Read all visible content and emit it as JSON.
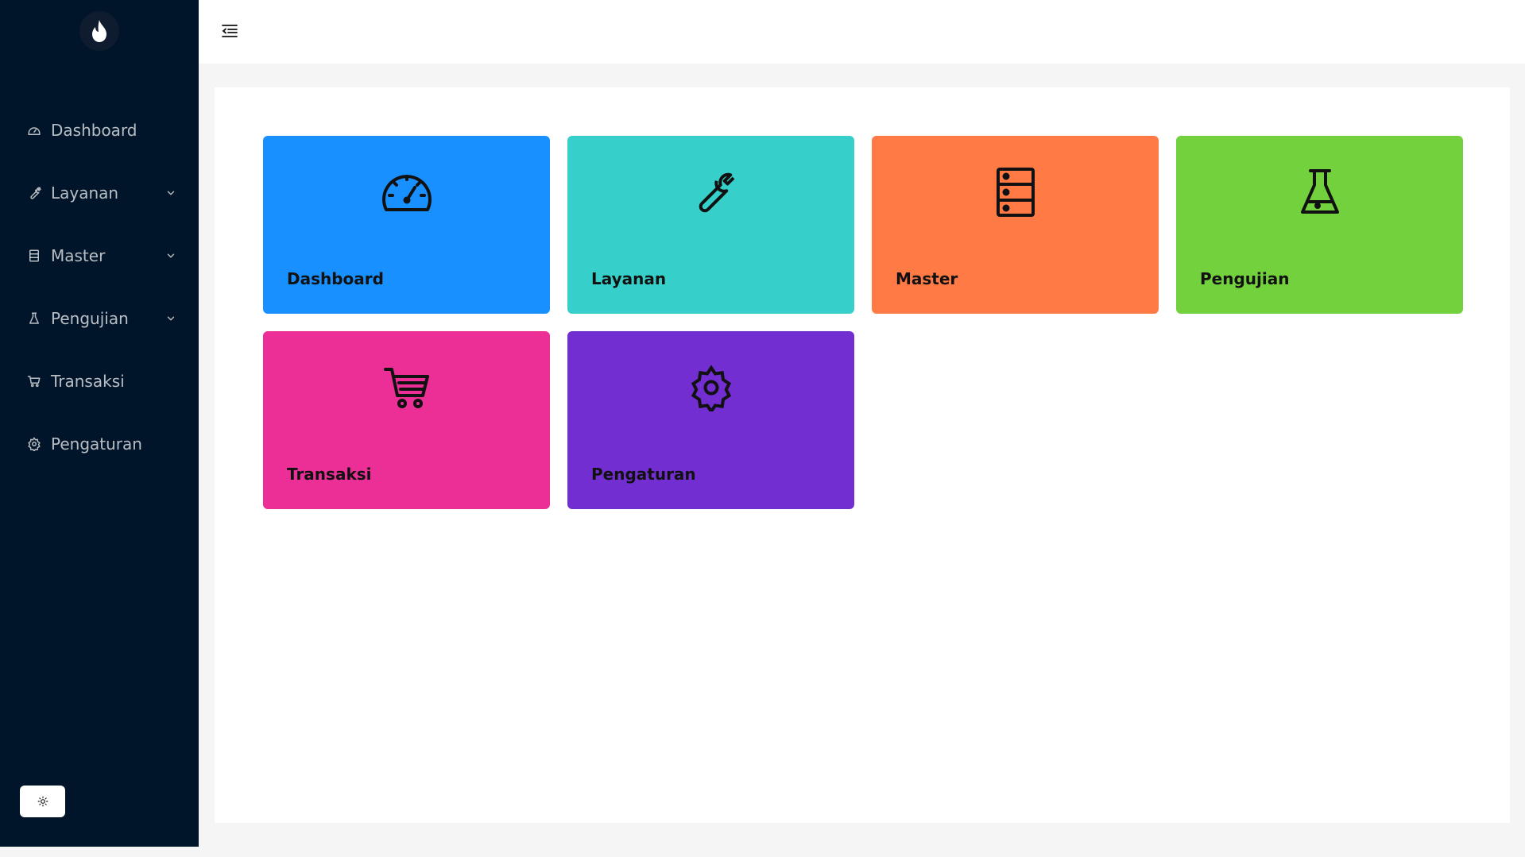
{
  "sidebar": {
    "logo_icon": "flame-icon",
    "items": [
      {
        "label": "Dashboard",
        "icon": "dashboard-icon",
        "has_submenu": false
      },
      {
        "label": "Layanan",
        "icon": "tool-icon",
        "has_submenu": true
      },
      {
        "label": "Master",
        "icon": "database-icon",
        "has_submenu": true
      },
      {
        "label": "Pengujian",
        "icon": "flask-icon",
        "has_submenu": true
      },
      {
        "label": "Transaksi",
        "icon": "cart-icon",
        "has_submenu": false
      },
      {
        "label": "Pengaturan",
        "icon": "gear-icon",
        "has_submenu": false
      }
    ],
    "theme_toggle_icon": "sun-icon"
  },
  "header": {
    "menu_toggle_icon": "menu-fold-icon"
  },
  "tiles": [
    {
      "label": "Dashboard",
      "icon": "dashboard-icon",
      "color": "#1890ff"
    },
    {
      "label": "Layanan",
      "icon": "tool-icon",
      "color": "#36cfc9"
    },
    {
      "label": "Master",
      "icon": "database-icon",
      "color": "#ff7a45"
    },
    {
      "label": "Pengujian",
      "icon": "flask-icon",
      "color": "#73d13d"
    },
    {
      "label": "Transaksi",
      "icon": "cart-icon",
      "color": "#eb2f96"
    },
    {
      "label": "Pengaturan",
      "icon": "gear-icon",
      "color": "#722ed1"
    }
  ],
  "colors": {
    "sidebar_bg": "#001529",
    "page_bg": "#f5f5f5",
    "content_bg": "#ffffff"
  }
}
